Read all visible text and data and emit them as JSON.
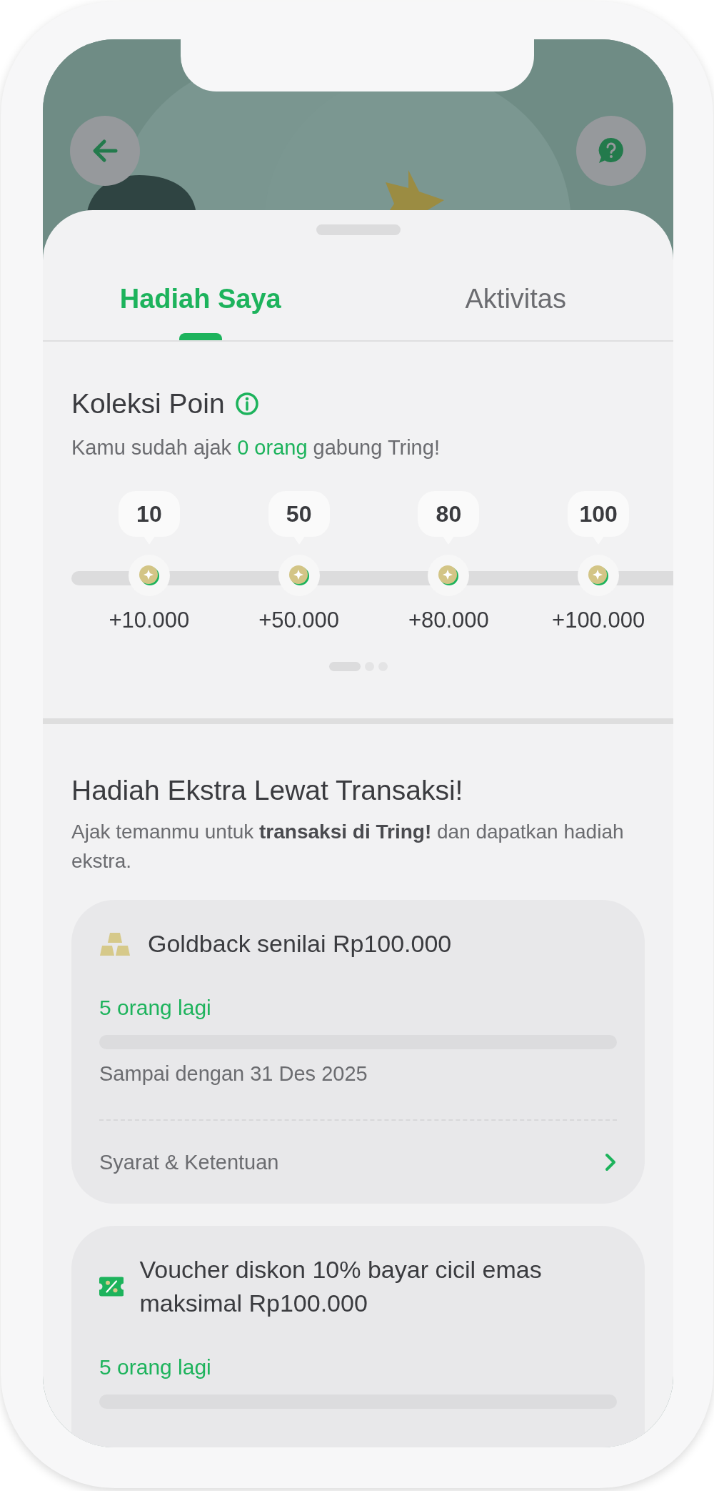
{
  "tabs": [
    {
      "label": "Hadiah Saya",
      "selected": true
    },
    {
      "label": "Aktivitas",
      "selected": false
    }
  ],
  "points": {
    "title": "Koleksi Poin",
    "subtitle_before": "Kamu sudah ajak",
    "count": "0 orang",
    "subtitle_after": "gabung Tring!",
    "milestones": [
      {
        "points": "10",
        "reward": "+10.000"
      },
      {
        "points": "50",
        "reward": "+50.000"
      },
      {
        "points": "80",
        "reward": "+80.000"
      },
      {
        "points": "100",
        "reward": "+100.000"
      }
    ],
    "pager": [
      {
        "selected": true
      },
      {
        "selected": false
      },
      {
        "selected": false
      }
    ]
  },
  "extra": {
    "title": "Hadiah Ekstra Lewat Transaksi!",
    "description": "Ajak temanmu untuk **transaksi di Tring!** dan dapatkan hadiah ekstra.",
    "rewards": [
      {
        "kind": "gold",
        "title": "Goldback senilai Rp100.000",
        "remaining": "5 orang lagi",
        "level": 0,
        "deadline": "Sampai dengan 31 Des 2025",
        "terms": "Syarat & Ketentuan"
      },
      {
        "kind": "voucher",
        "title": "Voucher diskon 10% bayar cicil emas maksimal Rp100.000",
        "remaining": "5 orang lagi",
        "level": 0
      }
    ]
  }
}
